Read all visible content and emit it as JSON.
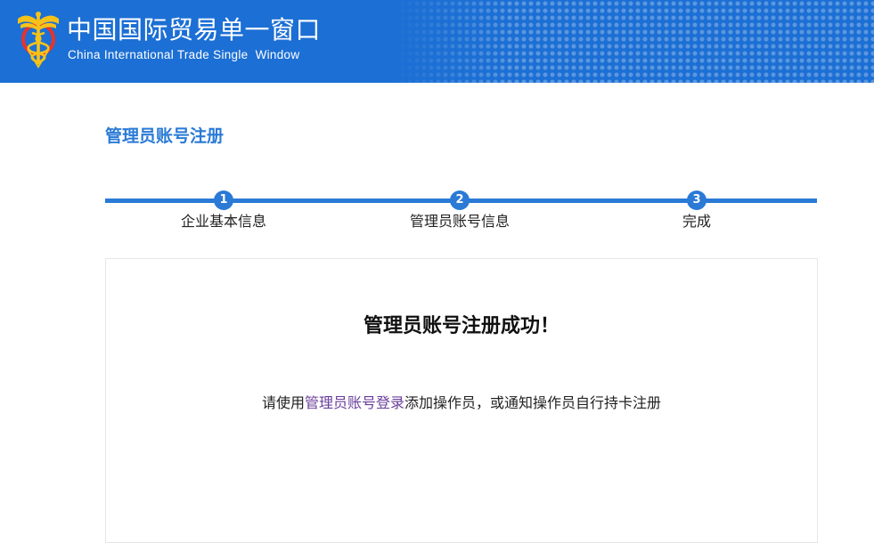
{
  "header": {
    "title": "中国国际贸易单一窗口",
    "subtitle": "China International Trade Single  Window",
    "logo_icon": "customs-emblem-icon",
    "background_color": "#1c6fd4"
  },
  "page": {
    "title": "管理员账号注册"
  },
  "steps": [
    {
      "number": "1",
      "label": "企业基本信息"
    },
    {
      "number": "2",
      "label": "管理员账号信息"
    },
    {
      "number": "3",
      "label": "完成"
    }
  ],
  "result": {
    "title": "管理员账号注册成功！",
    "message_prefix": "请使用",
    "message_link": "管理员账号登录",
    "message_suffix": "添加操作员，或通知操作员自行持卡注册"
  },
  "colors": {
    "accent": "#2a7ad6",
    "link": "#6a3d9a"
  }
}
